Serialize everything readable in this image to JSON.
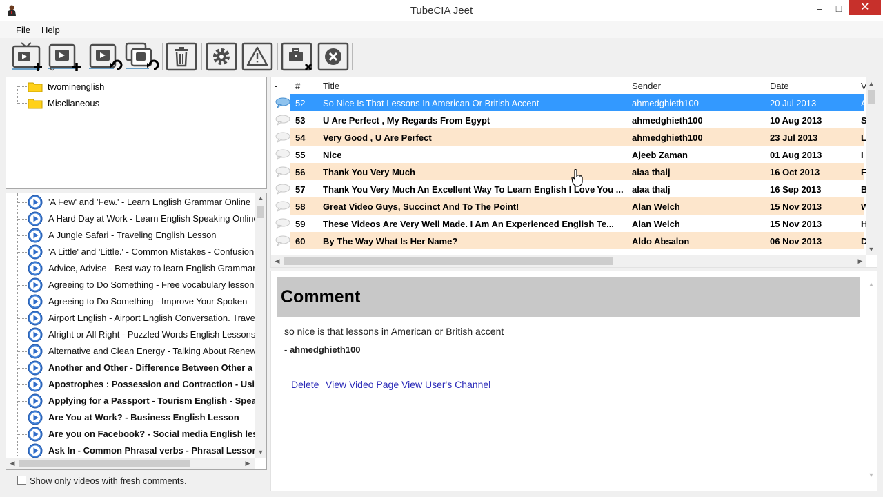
{
  "window": {
    "title": "TubeCIA Jeet",
    "minimize": "‒",
    "maximize": "□",
    "close": "✕"
  },
  "menu": [
    "File",
    "Help"
  ],
  "toolbar": {
    "buttons": [
      {
        "name": "add-channel-button",
        "icon": "tv-add-icon"
      },
      {
        "name": "add-video-button",
        "icon": "video-add-icon"
      },
      {
        "name": "refresh-video-button",
        "icon": "video-refresh-icon"
      },
      {
        "name": "refresh-all-button",
        "icon": "videos-refresh-icon"
      },
      {
        "name": "delete-button",
        "icon": "trash-icon"
      },
      {
        "name": "settings-button",
        "icon": "gear-icon"
      },
      {
        "name": "warning-button",
        "icon": "warning-icon"
      },
      {
        "name": "remove-toolbox-button",
        "icon": "toolbox-remove-icon"
      },
      {
        "name": "stop-button",
        "icon": "close-circle-icon"
      }
    ]
  },
  "folders": [
    {
      "label": "twominenglish"
    },
    {
      "label": "Miscllaneous"
    }
  ],
  "videos": [
    {
      "label": "'A Few' and 'Few.' - Learn English Grammar Online",
      "bold": false
    },
    {
      "label": "A Hard Day at Work - Learn English Speaking Online",
      "bold": false
    },
    {
      "label": "A Jungle Safari - Traveling English Lesson",
      "bold": false
    },
    {
      "label": "'A Little' and 'Little.' - Common Mistakes - Confusion",
      "bold": false
    },
    {
      "label": "Advice, Advise - Best way to learn English Grammar",
      "bold": false
    },
    {
      "label": "Agreeing to Do Something - Free vocabulary lesson",
      "bold": false
    },
    {
      "label": "Agreeing to Do Something - Improve Your Spoken",
      "bold": false
    },
    {
      "label": "Airport English - Airport English Conversation. Travel",
      "bold": false
    },
    {
      "label": "Alright or All Right - Puzzled Words English Lessons",
      "bold": false
    },
    {
      "label": "Alternative and Clean Energy - Talking About Renew",
      "bold": false
    },
    {
      "label": "Another and Other - Difference Between Other a",
      "bold": true
    },
    {
      "label": "Apostrophes : Possession and Contraction - Usin",
      "bold": true
    },
    {
      "label": "Applying for a Passport - Tourism English - Spea",
      "bold": true
    },
    {
      "label": "Are You at Work? - Business English Lesson",
      "bold": true
    },
    {
      "label": "Are you on Facebook? - Social media English less",
      "bold": true
    },
    {
      "label": "Ask In - Common Phrasal verbs - Phrasal Lesson",
      "bold": true
    }
  ],
  "fresh_filter": {
    "label": "Show only videos with fresh comments.",
    "checked": false
  },
  "grid": {
    "headers": {
      "dash": "-",
      "num": "#",
      "title": "Title",
      "sender": "Sender",
      "date": "Date",
      "v": "V"
    },
    "rows": [
      {
        "num": "52",
        "title": "So Nice Is That Lessons In American Or British Accent",
        "sender": "ahmedghieth100",
        "date": "20 Jul 2013",
        "v": "A",
        "style": "selected"
      },
      {
        "num": "53",
        "title": "U Are Perfect , My Regards From Egypt",
        "sender": "ahmedghieth100",
        "date": "10 Aug 2013",
        "v": "S",
        "style": "white"
      },
      {
        "num": "54",
        "title": "Very Good , U Are Perfect",
        "sender": "ahmedghieth100",
        "date": "23 Jul 2013",
        "v": "L",
        "style": "peach"
      },
      {
        "num": "55",
        "title": "Nice",
        "sender": "Ajeeb Zaman",
        "date": "01 Aug 2013",
        "v": "I",
        "style": "white"
      },
      {
        "num": "56",
        "title": "Thank You Very Much",
        "sender": "alaa thalj",
        "date": "16 Oct 2013",
        "v": "F",
        "style": "peach"
      },
      {
        "num": "57",
        "title": "Thank You Very Much An Excellent Way To Learn English I Love You ...",
        "sender": "alaa thalj",
        "date": "16 Sep 2013",
        "v": "B",
        "style": "white"
      },
      {
        "num": "58",
        "title": "Great Video Guys, Succinct And To The Point!",
        "sender": "Alan Welch",
        "date": "15 Nov 2013",
        "v": "W",
        "style": "peach"
      },
      {
        "num": "59",
        "title": "These Videos Are Very Well Made.   I Am An Experienced English Te...",
        "sender": "Alan Welch",
        "date": "15 Nov 2013",
        "v": "H",
        "style": "white"
      },
      {
        "num": "60",
        "title": "By The Way What Is Her Name?",
        "sender": "Aldo Absalon",
        "date": "06 Nov 2013",
        "v": "D",
        "style": "peach"
      }
    ]
  },
  "comment": {
    "heading": "Comment",
    "text": "so nice is that lessons in American or British accent",
    "author": "- ahmedghieth100",
    "links": {
      "delete": "Delete",
      "video_page": "View Video Page",
      "channel": "View User's Channel"
    }
  },
  "colors": {
    "selected": "#3399ff",
    "peach": "#fde6cc",
    "white": "#ffffff",
    "comment_header": "#c8c8c8"
  }
}
